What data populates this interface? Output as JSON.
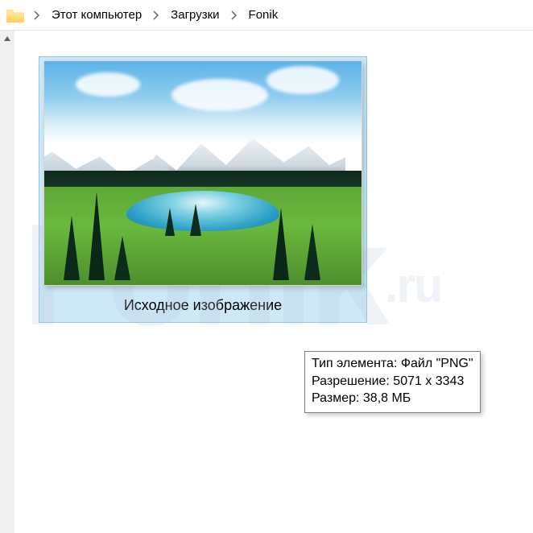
{
  "breadcrumb": {
    "items": [
      {
        "label": "Этот компьютер"
      },
      {
        "label": "Загрузки"
      },
      {
        "label": "Fonik"
      }
    ]
  },
  "file": {
    "name": "Исходное изображение"
  },
  "tooltip": {
    "type_label": "Тип элемента:",
    "type_value": "Файл \"PNG\"",
    "resolution_label": "Разрешение:",
    "resolution_value": "5071 x 3343",
    "size_label": "Размер:",
    "size_value": "38,8 МБ"
  },
  "watermark": {
    "main": "Fonik",
    "suffix": ".ru"
  }
}
